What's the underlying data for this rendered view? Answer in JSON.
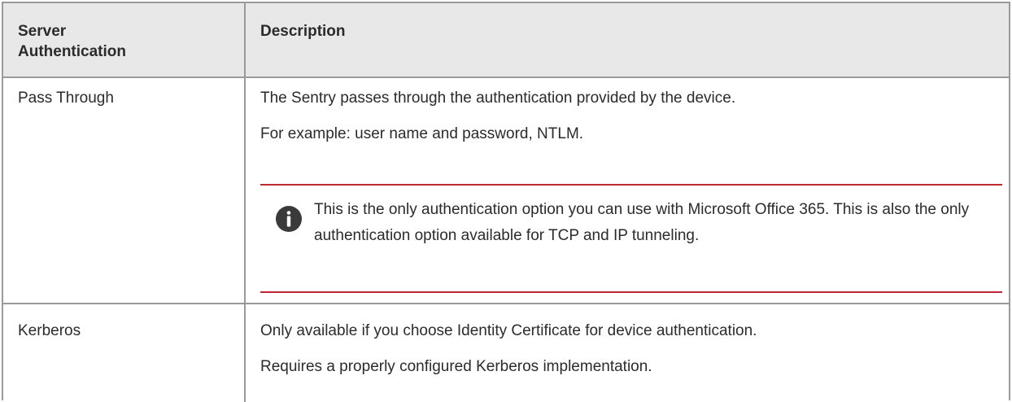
{
  "header": {
    "col1_line1": "Server",
    "col1_line2": "Authentication",
    "col2": "Description"
  },
  "rows": [
    {
      "name": "Pass Through",
      "lines": [
        "The Sentry passes through the authentication provided by the device.",
        "For example: user name and password, NTLM."
      ],
      "note": {
        "icon": "info-icon",
        "text": "This is the only authentication option you can use with Microsoft Office 365. This is also the only authentication option available for TCP and IP tunneling."
      }
    },
    {
      "name": "Kerberos",
      "lines": [
        "Only available if you choose Identity Certificate for device authentication.",
        "Requires a properly configured Kerberos implementation."
      ]
    }
  ],
  "colors": {
    "header_bg": "#e8e8e8",
    "border": "#9a9a9a",
    "note_rule": "#c0292f",
    "icon": "#3a3a3a"
  }
}
